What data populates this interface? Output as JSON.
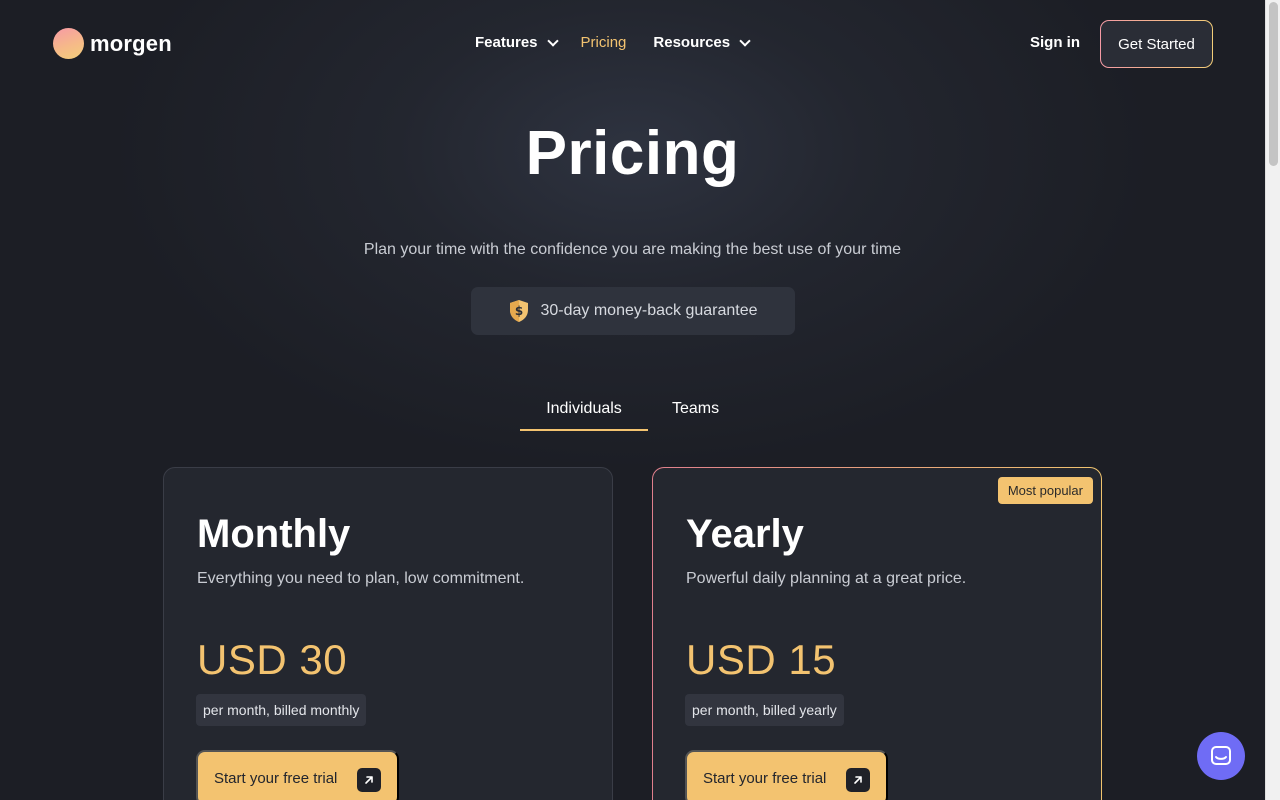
{
  "header": {
    "brand": "morgen",
    "nav": [
      {
        "label": "Features",
        "has_dropdown": true,
        "active": false
      },
      {
        "label": "Pricing",
        "has_dropdown": false,
        "active": true
      },
      {
        "label": "Resources",
        "has_dropdown": true,
        "active": false
      }
    ],
    "sign_in": "Sign in",
    "get_started": "Get Started"
  },
  "hero": {
    "title": "Pricing",
    "subtitle": "Plan your time with the confidence you are making the best use of your time",
    "guarantee": "30-day money-back guarantee"
  },
  "tabs": [
    {
      "label": "Individuals",
      "selected": true
    },
    {
      "label": "Teams",
      "selected": false
    }
  ],
  "plans": [
    {
      "name": "Monthly",
      "description": "Everything you need to plan, low commitment.",
      "price": "USD 30",
      "billing": "per month, billed monthly",
      "cta": "Start your free trial",
      "badge": ""
    },
    {
      "name": "Yearly",
      "description": "Powerful daily planning at a great price.",
      "price": "USD 15",
      "billing": "per month, billed yearly",
      "cta": "Start your free trial",
      "badge": "Most popular"
    }
  ],
  "colors": {
    "accent": "#f3c370",
    "background": "#1b1d24",
    "chat": "#6f6cf5",
    "gradient_start": "#f59aa5",
    "gradient_end": "#f3cd78"
  },
  "icons": {
    "guarantee": "shield-dollar-icon",
    "cta": "arrow-up-right-icon",
    "chat": "chat-bubble-icon"
  }
}
